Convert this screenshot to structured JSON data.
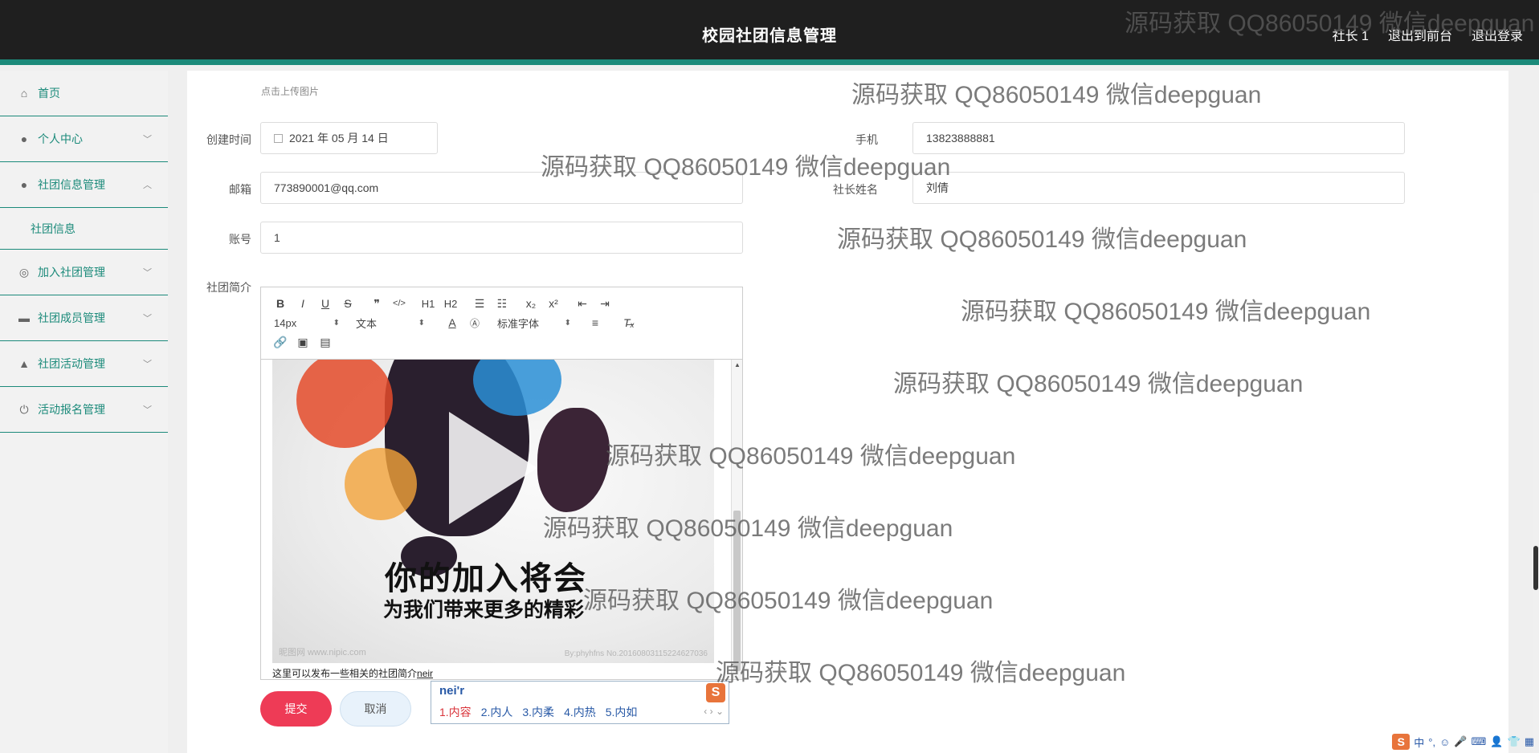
{
  "header": {
    "title": "校园社团信息管理",
    "nav": [
      "社长 1",
      "退出到前台",
      "退出登录"
    ]
  },
  "sidebar": {
    "items": [
      {
        "label": "首页",
        "icon": "home-icon"
      },
      {
        "label": "个人中心",
        "icon": "user-icon"
      },
      {
        "label": "社团信息管理",
        "icon": "user-icon"
      },
      {
        "label": "加入社团管理",
        "icon": "circle-icon"
      },
      {
        "label": "社团成员管理",
        "icon": "briefcase-icon"
      },
      {
        "label": "社团活动管理",
        "icon": "thumbs-up-icon"
      },
      {
        "label": "活动报名管理",
        "icon": "power-icon"
      }
    ],
    "sub_item": "社团信息"
  },
  "form": {
    "upload_hint": "点击上传图片",
    "created_label": "创建时间",
    "created_value": "2021 年 05 月 14 日",
    "phone_label": "手机",
    "phone_value": "13823888881",
    "email_label": "邮箱",
    "email_value": "773890001@qq.com",
    "leader_label": "社长姓名",
    "leader_value": "刘倩",
    "account_label": "账号",
    "account_value": "1",
    "intro_label": "社团简介"
  },
  "editor": {
    "toolbar_row1": [
      "B",
      "I",
      "U",
      "S",
      "❞",
      "</>",
      "H1",
      "H2",
      "☰",
      "☷",
      "x₂",
      "x²",
      "⇤",
      "⇥"
    ],
    "font_size": "14px",
    "text_type": "文本",
    "font_family": "标准字体",
    "poster_big": "你的加入将会",
    "poster_small": "为我们带来更多的精彩",
    "poster_wm_left": "昵图网 www.nipic.com",
    "poster_wm_right": "By:phyhfns No.20160803115224627036",
    "caption": "这里可以发布一些相关的社团简介",
    "caption_typed": "neir"
  },
  "buttons": {
    "submit": "提交",
    "cancel": "取消"
  },
  "ime": {
    "typed": "nei'r",
    "candidates": [
      "1.内容",
      "2.内人",
      "3.内柔",
      "4.内热",
      "5.内如"
    ],
    "logo": "S",
    "pager": "‹ › ⌄"
  },
  "tray": {
    "logo": "S",
    "items": [
      "中",
      "°,",
      "☺",
      "🎤",
      "⌨",
      "👤",
      "👕",
      "▦"
    ]
  },
  "watermark": "源码获取 QQ86050149 微信deepguan",
  "colors": {
    "accent": "#1b8a7a",
    "header_bg": "#1f1f1f",
    "submit": "#ee3b56"
  }
}
